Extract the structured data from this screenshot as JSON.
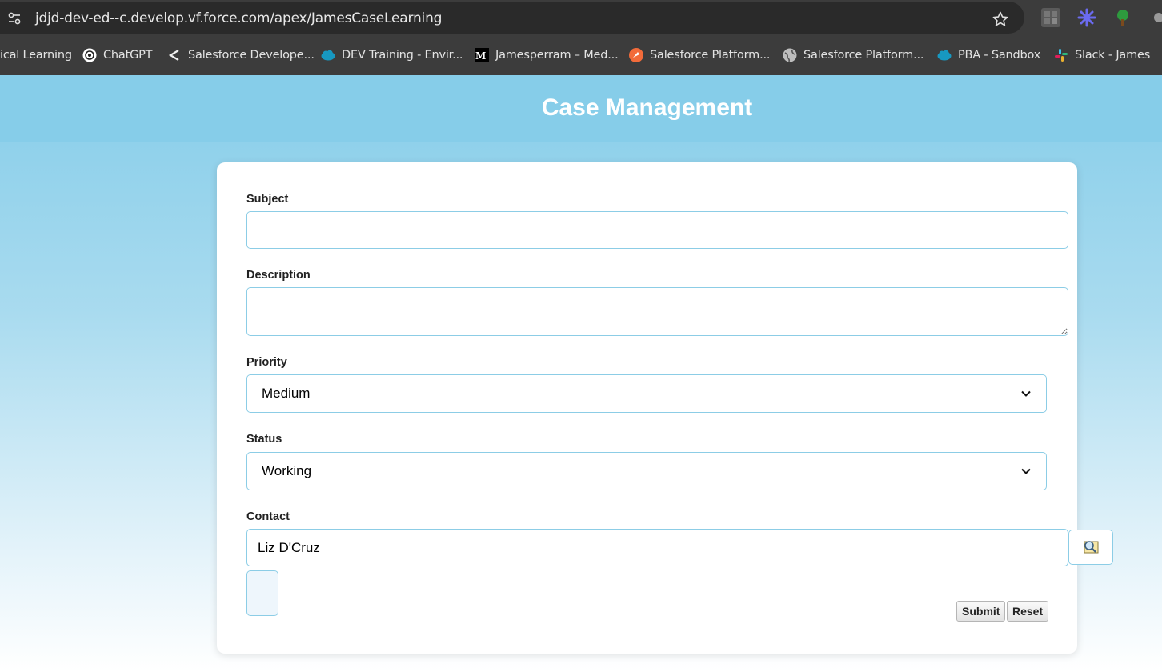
{
  "browser": {
    "url": "jdjd-dev-ed--c.develop.vf.force.com/apex/JamesCaseLearning",
    "bookmarks": [
      {
        "label": "ical Learning",
        "icon": "none"
      },
      {
        "label": "ChatGPT",
        "icon": "chatgpt-icon"
      },
      {
        "label": "Salesforce Develope...",
        "icon": "chevron-left-icon"
      },
      {
        "label": "DEV Training - Envir...",
        "icon": "salesforce-cloud-icon"
      },
      {
        "label": "Jamesperram – Med...",
        "icon": "medium-icon"
      },
      {
        "label": "Salesforce Platform...",
        "icon": "trailhead-icon"
      },
      {
        "label": "Salesforce Platform...",
        "icon": "globe-icon"
      },
      {
        "label": "PBA - Sandbox",
        "icon": "salesforce-cloud-icon"
      },
      {
        "label": "Slack - James",
        "icon": "slack-icon"
      }
    ],
    "colors": {
      "chrome": "#3c3c3c",
      "urlbox": "#2a2a2a"
    }
  },
  "page": {
    "title": "Case Management",
    "colors": {
      "header": "#86cde9",
      "border": "#8ccde6"
    }
  },
  "form": {
    "subject": {
      "label": "Subject",
      "value": ""
    },
    "description": {
      "label": "Description",
      "value": ""
    },
    "priority": {
      "label": "Priority",
      "value": "Medium"
    },
    "status": {
      "label": "Status",
      "value": "Working"
    },
    "contact": {
      "label": "Contact",
      "value": "Liz D'Cruz"
    },
    "submit_label": "Submit",
    "reset_label": "Reset"
  }
}
